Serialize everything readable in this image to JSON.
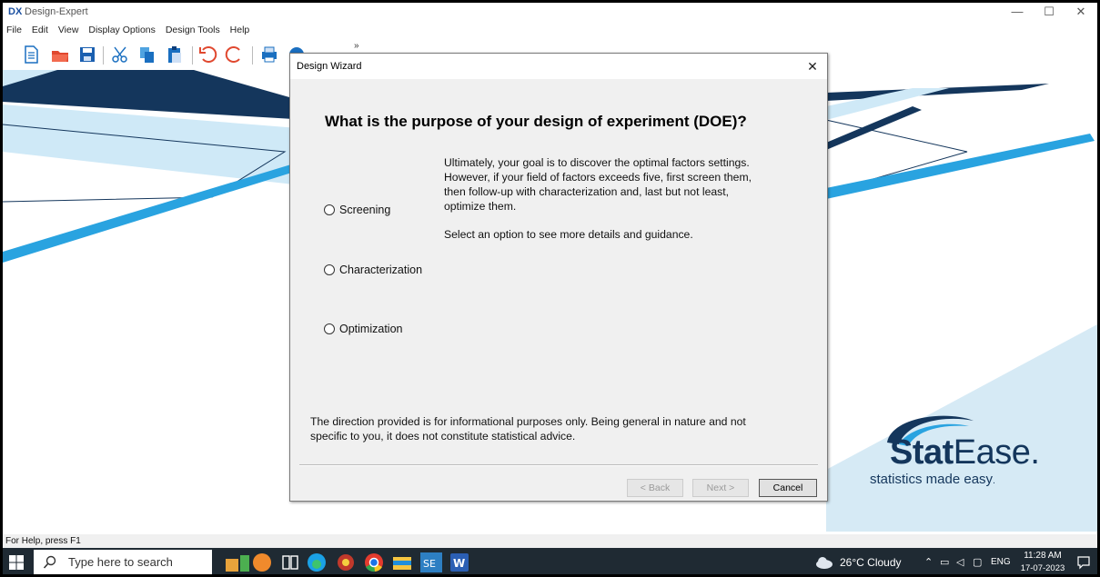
{
  "window": {
    "app_icon": "DX",
    "title": "Design-Expert",
    "minimize": "—",
    "maximize": "☐",
    "close": "✕"
  },
  "menu": {
    "items": [
      "File",
      "Edit",
      "View",
      "Display Options",
      "Design Tools",
      "Help"
    ],
    "overflow": "»"
  },
  "toolbar": {
    "icons": [
      "new-file-icon",
      "open-folder-icon",
      "save-icon",
      "cut-icon",
      "copy-icon",
      "paste-icon",
      "undo-icon",
      "redo-icon",
      "print-icon",
      "help-icon"
    ]
  },
  "dialog": {
    "title": "Design Wizard",
    "close": "✕",
    "heading": "What is the purpose of your design of experiment (DOE)?",
    "description_lines": [
      "Ultimately, your goal is to discover the optimal factors settings.",
      "However, if your field of factors exceeds five, first screen them,",
      "then follow-up with characterization and, last but not least,",
      "optimize them."
    ],
    "hint": "Select an option to see more details and guidance.",
    "options": [
      {
        "label": "Screening",
        "selected": false
      },
      {
        "label": "Characterization",
        "selected": false
      },
      {
        "label": "Optimization",
        "selected": false
      }
    ],
    "disclaimer_lines": [
      "The direction provided is for informational purposes only. Being general in nature and not",
      "specific to you, it does not constitute statistical advice."
    ],
    "buttons": {
      "back": "< Back",
      "next": "Next >",
      "cancel": "Cancel"
    }
  },
  "logo": {
    "word_bold": "Stat",
    "word_light": "Ease",
    "dot": ".",
    "tagline": "statistics made easy",
    "tagline_mark": "."
  },
  "statusbar": {
    "text": "For Help, press F1"
  },
  "taskbar": {
    "search_placeholder": "Type here to search",
    "weather": "26°C  Cloudy",
    "language": "ENG",
    "time": "11:28 AM",
    "date": "17-07-2023"
  },
  "colors": {
    "navy": "#14365c",
    "sky": "#29a3e0",
    "light_sky": "#cfe9f7",
    "taskbar": "#1f2a33"
  }
}
